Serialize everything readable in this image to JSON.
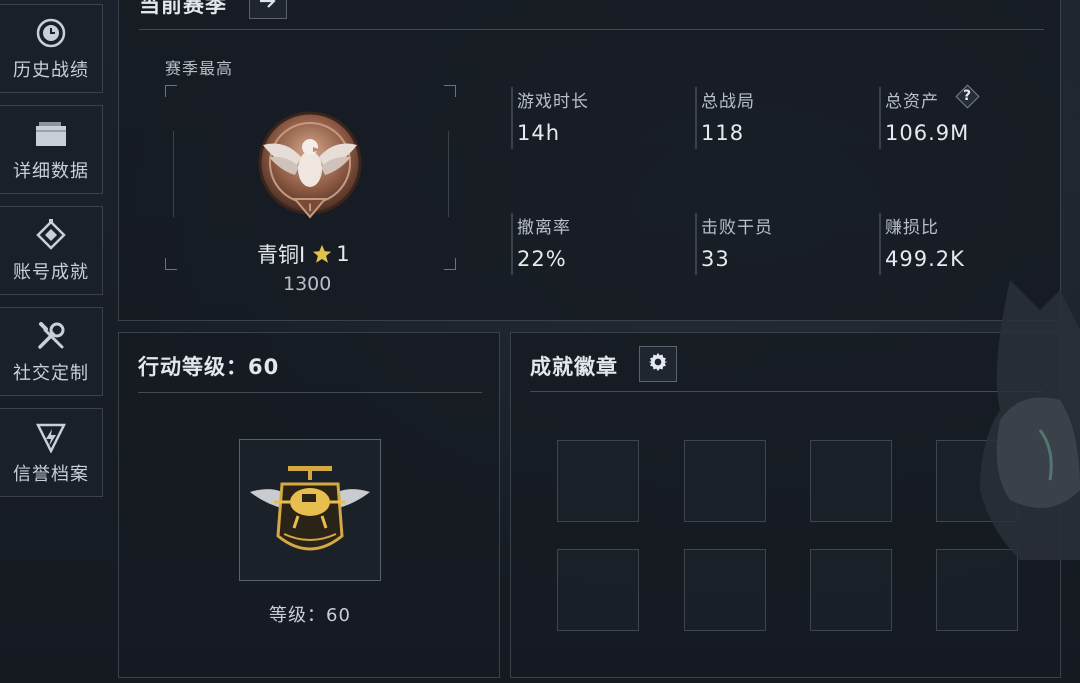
{
  "sidebar": {
    "items": [
      {
        "label": "历史战绩",
        "icon": "history-clock-icon"
      },
      {
        "label": "详细数据",
        "icon": "folder-icon"
      },
      {
        "label": "账号成就",
        "icon": "achievement-diamond-icon"
      },
      {
        "label": "社交定制",
        "icon": "wrench-screwdriver-icon"
      },
      {
        "label": "信誉档案",
        "icon": "shield-lightning-icon"
      }
    ]
  },
  "season": {
    "title": "当前赛季",
    "arrow_icon": "arrow-right-icon",
    "best_label": "赛季最高",
    "rank_icon": "bronze-eagle-rank-icon",
    "rank_name": "青铜I",
    "star_icon": "star-icon",
    "rank_stars": "1",
    "rank_points": "1300",
    "stats": [
      {
        "label": "游戏时长",
        "value": "14h"
      },
      {
        "label": "总战局",
        "value": "118"
      },
      {
        "label": "总资产",
        "value": "106.9M",
        "help": "?"
      },
      {
        "label": "撤离率",
        "value": "22%"
      },
      {
        "label": "击败干员",
        "value": "33"
      },
      {
        "label": "赚损比",
        "value": "499.2K"
      }
    ]
  },
  "level": {
    "title": "行动等级：60",
    "badge_icon": "helicopter-wings-badge-icon",
    "level_text": "等级：60"
  },
  "achievements": {
    "title": "成就徽章",
    "settings_icon": "gear-icon",
    "slot_count": 8
  },
  "colors": {
    "background": "#171c24",
    "border": "#39414c",
    "text": "#d7dce2",
    "star": "#e2c24a",
    "bronze": "#a8755d"
  }
}
